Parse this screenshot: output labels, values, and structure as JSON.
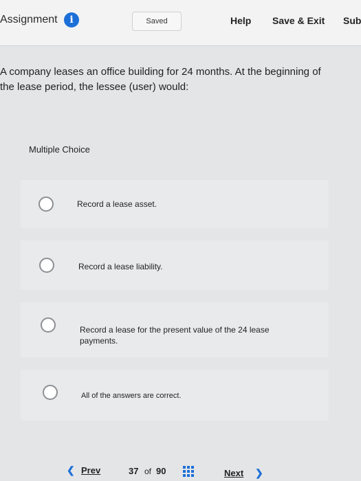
{
  "header": {
    "title": "Assignment",
    "info_symbol": "i",
    "saved_label": "Saved",
    "help_label": "Help",
    "save_exit_label": "Save & Exit",
    "submit_label": "Sub"
  },
  "question": {
    "line1": "A company leases an office building for 24 months. At the beginning of",
    "line2": "the lease period, the lessee (user) would:"
  },
  "choices": {
    "type_label": "Multiple Choice",
    "options": [
      {
        "label": "Record a lease asset."
      },
      {
        "label": "Record a lease liability."
      },
      {
        "label": "Record a lease for the present value of the 24 lease payments."
      },
      {
        "label": "All of the answers are correct."
      }
    ]
  },
  "footer": {
    "prev_label": "Prev",
    "current_page": "37",
    "of_label": "of",
    "total_pages": "90",
    "next_label": "Next"
  },
  "colors": {
    "accent": "#1d6fd8",
    "background": "#e4e5e7",
    "header_background": "#f3f3f4"
  }
}
